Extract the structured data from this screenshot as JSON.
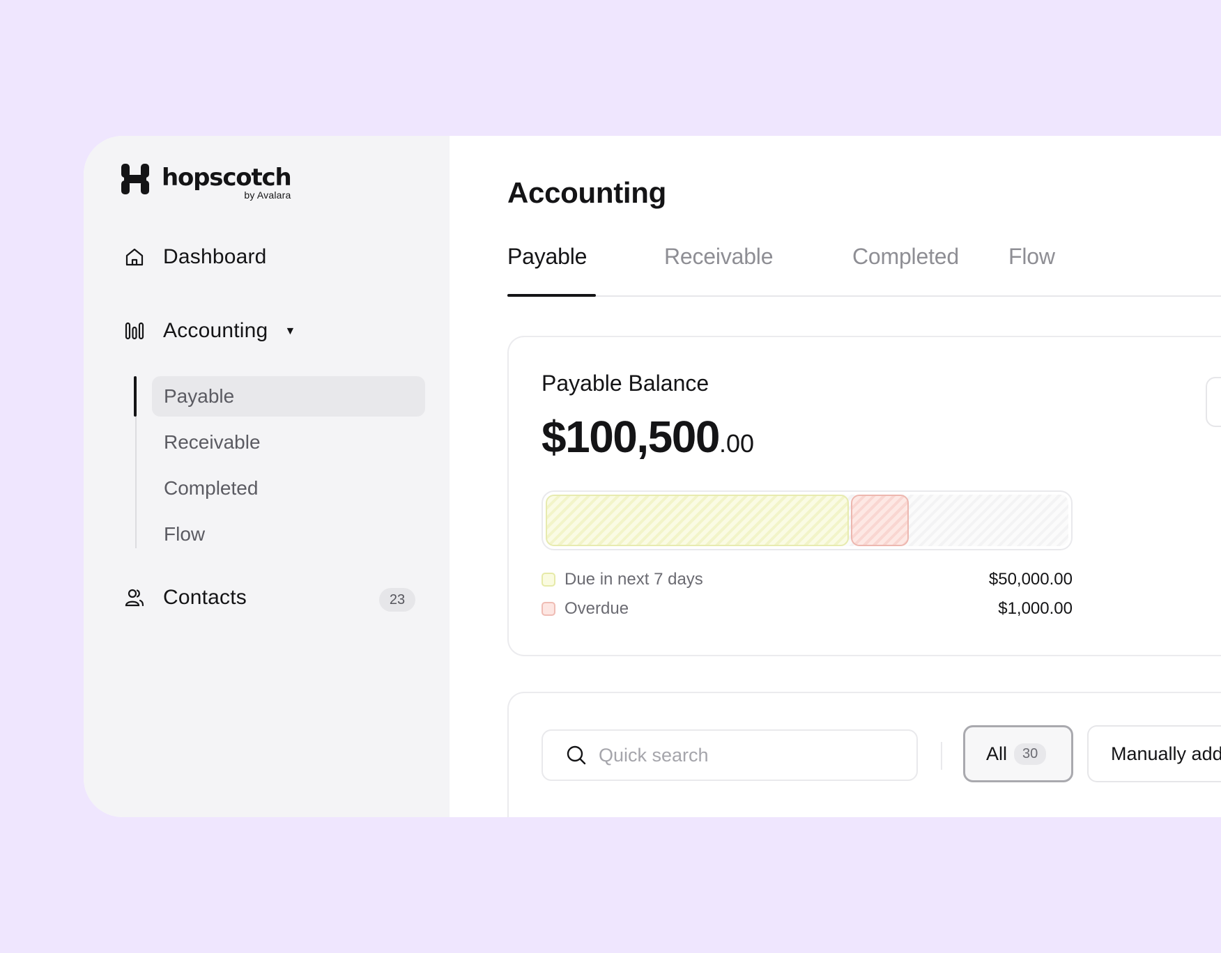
{
  "brand": {
    "name": "hopscotch",
    "sub": "by Avalara"
  },
  "sidebar": {
    "dashboard": "Dashboard",
    "accounting": "Accounting",
    "sub_items": [
      {
        "label": "Payable",
        "active": true
      },
      {
        "label": "Receivable",
        "active": false
      },
      {
        "label": "Completed",
        "active": false
      },
      {
        "label": "Flow",
        "active": false
      }
    ],
    "contacts": "Contacts",
    "contacts_count": "23"
  },
  "main": {
    "title": "Accounting",
    "tabs": [
      {
        "label": "Payable",
        "active": true
      },
      {
        "label": "Receivable",
        "active": false
      },
      {
        "label": "Completed",
        "active": false
      },
      {
        "label": "Flow",
        "active": false
      }
    ],
    "balance": {
      "label": "Payable Balance",
      "amount_whole": "$100,500",
      "amount_cents": ".00",
      "total_value": 100500,
      "segments": [
        {
          "name": "Due in next 7 days",
          "value_text": "$50,000.00",
          "share": 0.58,
          "color": "#f2f4c9"
        },
        {
          "name": "Overdue",
          "value_text": "$1,000.00",
          "share": 0.115,
          "color": "#f9d6d1"
        }
      ]
    },
    "search": {
      "placeholder": "Quick search"
    },
    "filters": {
      "all_label": "All",
      "all_count": "30",
      "manual_label": "Manually added"
    }
  },
  "colors": {
    "background": "#efe6fe",
    "sidebar": "#f4f4f6",
    "text": "#141416"
  }
}
